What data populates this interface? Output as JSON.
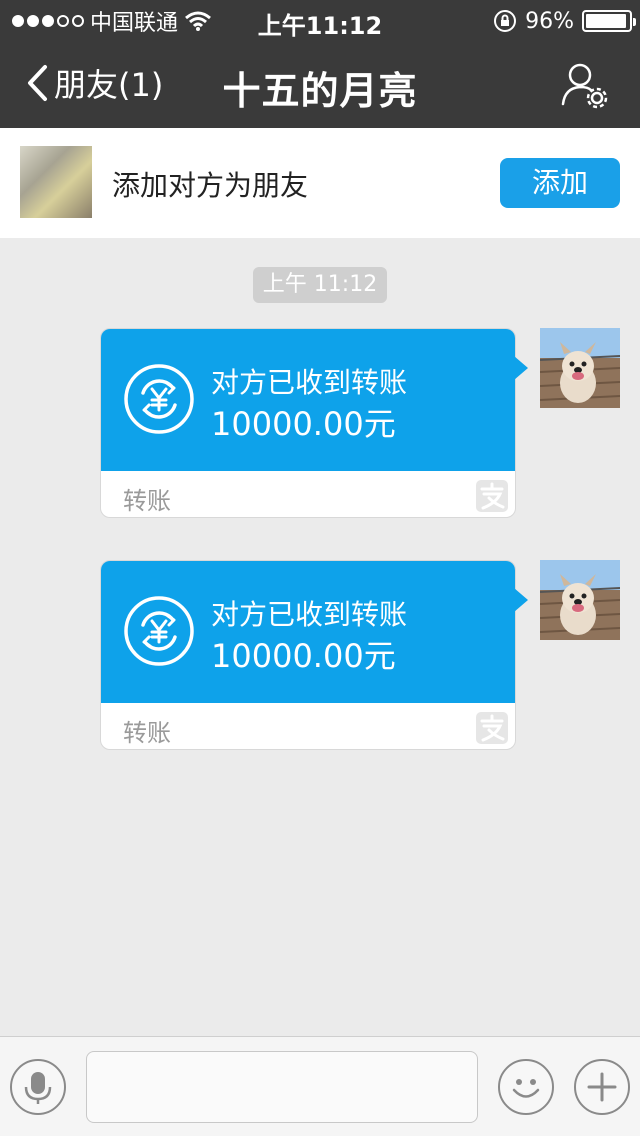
{
  "status_bar": {
    "carrier": "中国联通",
    "time": "上午11:12",
    "battery_percent": "96%",
    "battery_level": 0.96,
    "signal_bars_filled": 3,
    "signal_bars_total": 5
  },
  "nav": {
    "back_label": "朋友(1)",
    "title": "十五的月亮"
  },
  "banner": {
    "text": "添加对方为朋友",
    "button_label": "添加"
  },
  "chat": {
    "timestamp": "上午 11:12",
    "messages": [
      {
        "status": "对方已收到转账",
        "amount": "10000.00元",
        "type_label": "转账"
      },
      {
        "status": "对方已收到转账",
        "amount": "10000.00元",
        "type_label": "转账"
      }
    ]
  },
  "colors": {
    "header_bg": "#3a3a3a",
    "accent_blue": "#1aa0e8",
    "transfer_card_blue": "#0ea2ea",
    "chat_bg": "#ebebeb"
  },
  "icons": [
    "back-chevron-icon",
    "wifi-icon",
    "rotation-lock-icon",
    "battery-icon",
    "user-settings-icon",
    "yuan-transfer-icon",
    "alipay-icon",
    "microphone-icon",
    "emoji-icon",
    "plus-icon"
  ]
}
